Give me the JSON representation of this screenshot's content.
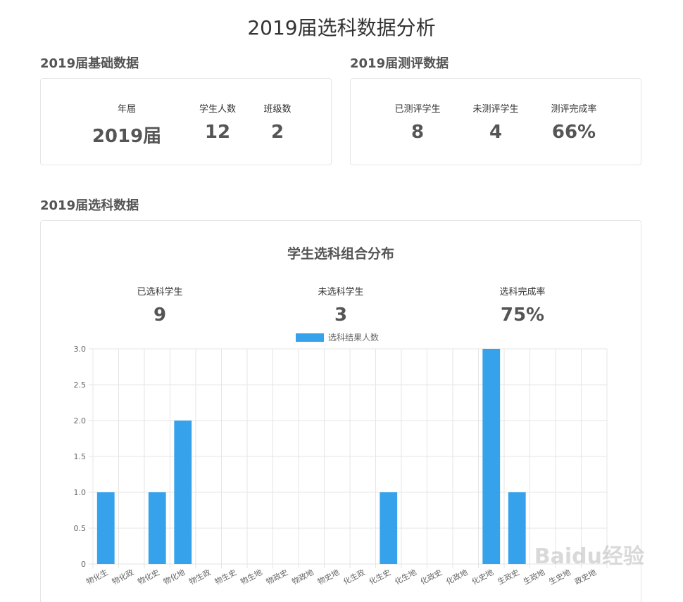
{
  "page_title": "2019届选科数据分析",
  "basic": {
    "title": "2019届基础数据",
    "stats": [
      {
        "label": "年届",
        "value": "2019届"
      },
      {
        "label": "学生人数",
        "value": "12"
      },
      {
        "label": "班级数",
        "value": "2"
      }
    ]
  },
  "evaluation": {
    "title": "2019届测评数据",
    "stats": [
      {
        "label": "已测评学生",
        "value": "8"
      },
      {
        "label": "未测评学生",
        "value": "4"
      },
      {
        "label": "测评完成率",
        "value": "66%"
      }
    ]
  },
  "selection": {
    "title": "2019届选科数据",
    "stats": [
      {
        "label": "已选科学生",
        "value": "9"
      },
      {
        "label": "未选科学生",
        "value": "3"
      },
      {
        "label": "选科完成率",
        "value": "75%"
      }
    ]
  },
  "watermark": "Baidu经验",
  "colors": {
    "bar": "#36a2eb",
    "grid": "#e5e5e5"
  },
  "chart_data": {
    "type": "bar",
    "title": "学生选科组合分布",
    "categories": [
      "物化生",
      "物化政",
      "物化史",
      "物化地",
      "物生政",
      "物生史",
      "物生地",
      "物政史",
      "物政地",
      "物史地",
      "化生政",
      "化生史",
      "化生地",
      "化政史",
      "化政地",
      "化史地",
      "生政史",
      "生政地",
      "生史地",
      "政史地"
    ],
    "series": [
      {
        "name": "选科结果人数",
        "values": [
          1,
          0,
          1,
          2,
          0,
          0,
          0,
          0,
          0,
          0,
          0,
          1,
          0,
          0,
          0,
          3,
          1,
          0,
          0,
          0
        ]
      }
    ],
    "ylim": [
      0,
      3
    ],
    "yticks": [
      "0",
      "0.5",
      "1.0",
      "1.5",
      "2.0",
      "2.5",
      "3.0"
    ],
    "grid": true,
    "legend": "top"
  }
}
